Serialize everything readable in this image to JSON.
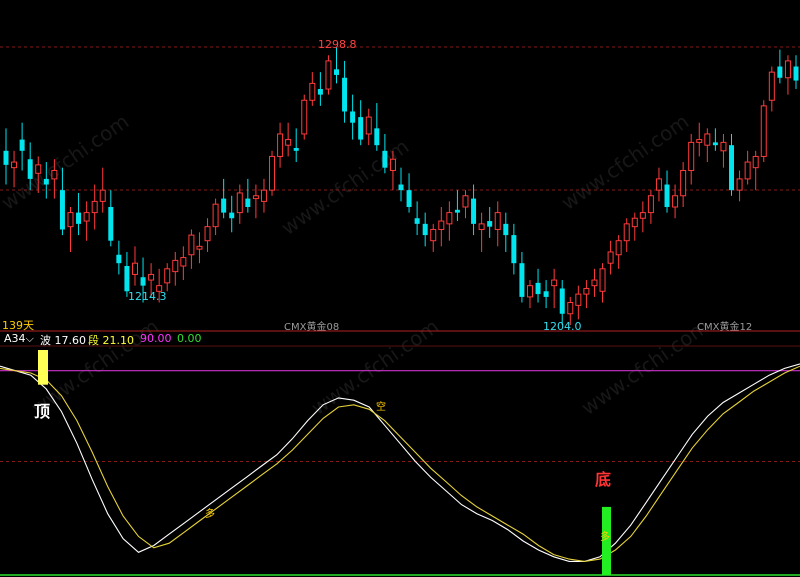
{
  "chart_data": [
    {
      "type": "candlestick",
      "instrument_labels": [
        "CMX黄金08",
        "CMX黄金12"
      ],
      "period_label": "139天",
      "ylim": [
        1200,
        1305
      ],
      "extreme_labels": {
        "high": "1298.8",
        "low1": "1214.3",
        "low2": "1204.0"
      },
      "colors": {
        "up": "#ff3b3b",
        "down": "#00e5ee",
        "grid": "#7a1010"
      },
      "candles": [
        [
          1262,
          1270,
          1250,
          1257
        ],
        [
          1256,
          1262,
          1249,
          1258
        ],
        [
          1266,
          1272,
          1255,
          1262
        ],
        [
          1259,
          1265,
          1248,
          1252
        ],
        [
          1254,
          1260,
          1247,
          1257
        ],
        [
          1252,
          1258,
          1245,
          1250
        ],
        [
          1252,
          1259,
          1245,
          1255
        ],
        [
          1248,
          1256,
          1232,
          1234
        ],
        [
          1235,
          1242,
          1226,
          1240
        ],
        [
          1240,
          1247,
          1232,
          1236
        ],
        [
          1237,
          1244,
          1230,
          1240
        ],
        [
          1240,
          1250,
          1234,
          1244
        ],
        [
          1244,
          1256,
          1240,
          1248
        ],
        [
          1242,
          1248,
          1228,
          1230
        ],
        [
          1225,
          1230,
          1218,
          1222
        ],
        [
          1221,
          1226,
          1210,
          1212
        ],
        [
          1218,
          1228,
          1214,
          1222
        ],
        [
          1217,
          1224,
          1208,
          1214
        ],
        [
          1216,
          1222,
          1210,
          1218
        ],
        [
          1212,
          1220,
          1208,
          1214
        ],
        [
          1215,
          1222,
          1212,
          1220
        ],
        [
          1219,
          1226,
          1214,
          1223
        ],
        [
          1221,
          1228,
          1216,
          1224
        ],
        [
          1225,
          1234,
          1220,
          1232
        ],
        [
          1227,
          1233,
          1222,
          1228
        ],
        [
          1230,
          1238,
          1226,
          1235
        ],
        [
          1235,
          1245,
          1232,
          1243
        ],
        [
          1245,
          1252,
          1238,
          1240
        ],
        [
          1240,
          1246,
          1233,
          1238
        ],
        [
          1240,
          1250,
          1236,
          1247
        ],
        [
          1245,
          1252,
          1240,
          1242
        ],
        [
          1245,
          1250,
          1238,
          1246
        ],
        [
          1244,
          1252,
          1240,
          1248
        ],
        [
          1248,
          1262,
          1246,
          1260
        ],
        [
          1260,
          1272,
          1256,
          1268
        ],
        [
          1264,
          1272,
          1260,
          1266
        ],
        [
          1263,
          1270,
          1258,
          1262
        ],
        [
          1268,
          1282,
          1266,
          1280
        ],
        [
          1280,
          1290,
          1278,
          1286
        ],
        [
          1284,
          1290,
          1278,
          1282
        ],
        [
          1284,
          1296,
          1282,
          1294
        ],
        [
          1291,
          1298.8,
          1286,
          1289
        ],
        [
          1288,
          1294,
          1272,
          1276
        ],
        [
          1276,
          1282,
          1266,
          1272
        ],
        [
          1274,
          1280,
          1264,
          1266
        ],
        [
          1268,
          1277,
          1264,
          1274
        ],
        [
          1270,
          1279,
          1262,
          1264
        ],
        [
          1262,
          1268,
          1254,
          1256
        ],
        [
          1255,
          1262,
          1248,
          1259
        ],
        [
          1250,
          1256,
          1244,
          1248
        ],
        [
          1248,
          1254,
          1240,
          1242
        ],
        [
          1238,
          1244,
          1232,
          1236
        ],
        [
          1236,
          1240,
          1228,
          1232
        ],
        [
          1230,
          1236,
          1226,
          1234
        ],
        [
          1234,
          1242,
          1228,
          1237
        ],
        [
          1236,
          1244,
          1230,
          1240
        ],
        [
          1241,
          1248,
          1237,
          1240
        ],
        [
          1242,
          1248,
          1238,
          1246
        ],
        [
          1245,
          1250,
          1232,
          1236
        ],
        [
          1234,
          1240,
          1226,
          1236
        ],
        [
          1237,
          1242,
          1231,
          1235
        ],
        [
          1234,
          1244,
          1228,
          1240
        ],
        [
          1236,
          1240,
          1226,
          1232
        ],
        [
          1232,
          1236,
          1218,
          1222
        ],
        [
          1222,
          1226,
          1208,
          1210
        ],
        [
          1210,
          1216,
          1206,
          1214
        ],
        [
          1215,
          1220,
          1208,
          1211
        ],
        [
          1212,
          1216,
          1206,
          1210
        ],
        [
          1214,
          1220,
          1206,
          1216
        ],
        [
          1213,
          1216,
          1200,
          1204
        ],
        [
          1204,
          1210,
          1200,
          1208
        ],
        [
          1207,
          1214,
          1202,
          1211
        ],
        [
          1211,
          1216,
          1206,
          1213
        ],
        [
          1214,
          1220,
          1210,
          1216
        ],
        [
          1212,
          1222,
          1208,
          1220
        ],
        [
          1222,
          1230,
          1218,
          1226
        ],
        [
          1225,
          1232,
          1220,
          1230
        ],
        [
          1230,
          1238,
          1226,
          1236
        ],
        [
          1235,
          1240,
          1230,
          1238
        ],
        [
          1238,
          1244,
          1233,
          1240
        ],
        [
          1240,
          1248,
          1236,
          1246
        ],
        [
          1248,
          1256,
          1244,
          1252
        ],
        [
          1250,
          1255,
          1240,
          1242
        ],
        [
          1242,
          1250,
          1238,
          1246
        ],
        [
          1246,
          1258,
          1242,
          1255
        ],
        [
          1255,
          1268,
          1250,
          1265
        ],
        [
          1265,
          1272,
          1260,
          1266
        ],
        [
          1264,
          1270,
          1258,
          1268
        ],
        [
          1265,
          1270,
          1262,
          1264
        ],
        [
          1262,
          1268,
          1256,
          1265
        ],
        [
          1264,
          1268,
          1246,
          1248
        ],
        [
          1248,
          1255,
          1244,
          1252
        ],
        [
          1252,
          1262,
          1250,
          1258
        ],
        [
          1256,
          1262,
          1248,
          1260
        ],
        [
          1260,
          1280,
          1258,
          1278
        ],
        [
          1280,
          1292,
          1276,
          1290
        ],
        [
          1292,
          1298,
          1286,
          1288
        ],
        [
          1288,
          1296,
          1282,
          1294
        ],
        [
          1292,
          1296,
          1284,
          1287
        ]
      ]
    },
    {
      "type": "line",
      "indicator_name": "A34",
      "dropdown_symbol": "⌵",
      "params": [
        {
          "label": "波",
          "value": "17.60",
          "color": "#ffffff"
        },
        {
          "label": "段",
          "value": "21.10",
          "color": "#ffff33"
        },
        {
          "label": "",
          "value": "90.00",
          "color": "#ff33ff"
        },
        {
          "label": "",
          "value": "0.00",
          "color": "#33dd33"
        }
      ],
      "ylim": [
        0,
        100
      ],
      "levels": {
        "magenta": 90,
        "red_dashed": 50
      },
      "series": [
        {
          "color": "#ffffff",
          "values": [
            92,
            90,
            88,
            82,
            72,
            58,
            42,
            27,
            16,
            10,
            13,
            18,
            23,
            28,
            33,
            38,
            43,
            48,
            53,
            60,
            68,
            75,
            78,
            77,
            74,
            66,
            58,
            50,
            43,
            37,
            31,
            27,
            24,
            20,
            15,
            11,
            8,
            6,
            6,
            8,
            14,
            22,
            32,
            42,
            52,
            62,
            70,
            76,
            80,
            84,
            88,
            91,
            93
          ]
        },
        {
          "color": "#e6d23a",
          "values": [
            91,
            90,
            89,
            86,
            79,
            68,
            54,
            39,
            26,
            17,
            12,
            14,
            19,
            24,
            29,
            34,
            39,
            44,
            49,
            55,
            62,
            69,
            74,
            75,
            73,
            68,
            61,
            54,
            47,
            41,
            35,
            30,
            26,
            22,
            18,
            13,
            9,
            7,
            6,
            7,
            11,
            17,
            26,
            36,
            46,
            56,
            64,
            71,
            76,
            81,
            85,
            89,
            92
          ]
        }
      ],
      "signals": [
        {
          "label": "顶",
          "color": "#ffff55",
          "bar_value": 90
        },
        {
          "label": "底",
          "color": "#ff3333",
          "bar_value": 30
        }
      ],
      "cross_labels": [
        "多",
        "空",
        "多"
      ]
    }
  ]
}
